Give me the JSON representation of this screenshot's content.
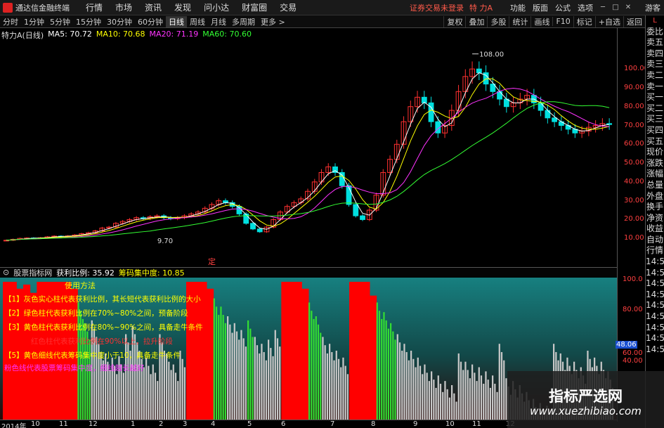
{
  "titlebar": {
    "app_title": "通达信金融终端",
    "menus": [
      "行情",
      "市场",
      "资讯",
      "发现",
      "问小达",
      "财富圈",
      "交易"
    ],
    "login_status": "证券交易未登录",
    "stock_name": "特 力A",
    "system_menus": [
      "功能",
      "版面",
      "公式",
      "选项"
    ],
    "guest": "游客"
  },
  "toolbar": {
    "periods": [
      "分时",
      "1分钟",
      "5分钟",
      "15分钟",
      "30分钟",
      "60分钟",
      "日线",
      "周线",
      "月线",
      "多周期",
      "更多 >"
    ],
    "active_period": "日线",
    "tools": [
      "复权",
      "叠加",
      "多股",
      "统计",
      "画线",
      "F10",
      "标记",
      "+自选",
      "返回"
    ]
  },
  "chart_header": {
    "stock_label": "特力A(日线)",
    "ma": [
      {
        "label": "MA5: 70.72",
        "color": "#ffffff"
      },
      {
        "label": "MA10: 70.68",
        "color": "#ffff00"
      },
      {
        "label": "MA20: 71.19",
        "color": "#ff33ff"
      },
      {
        "label": "MA60: 70.60",
        "color": "#33ff33"
      }
    ]
  },
  "price_axis": [
    "100.00",
    "90.00",
    "80.00",
    "70.00",
    "60.00",
    "50.00",
    "40.00",
    "30.00",
    "20.00",
    "10.00"
  ],
  "annotations": {
    "high": "108.00",
    "low": "9.70",
    "ding": "定"
  },
  "indicator": {
    "name": "股票指标网",
    "metrics": [
      {
        "label": "获利比例: 35.92",
        "color": "#ffffff"
      },
      {
        "label": "筹码集中度: 10.85",
        "color": "#ffff00"
      }
    ],
    "legend_title": "使用方法",
    "legend": [
      {
        "text": "【1】灰色实心柱代表获利比例，其长短代表获利比例的大小",
        "color": "#ffff00"
      },
      {
        "text": "【2】绿色柱代表获利比例在70%~80%之间，预备阶段",
        "color": "#ffff00"
      },
      {
        "text": "【3】黄色柱代表获利比例在80%~90%之间，具备走牛条件",
        "color": "#ffff00"
      },
      {
        "text": "红色柱代表获利比例在90%以上，拉升阶段",
        "color": "#ff3030"
      },
      {
        "text": "【5】黄色细线代表筹码集中度小于10，具备走牛条件",
        "color": "#ffff00"
      },
      {
        "text": "粉色线代表股票筹码集中度，细线越长越好",
        "color": "#ff33ff"
      }
    ],
    "axis": [
      "100.0",
      "80.00",
      "60.00",
      "40.00"
    ],
    "current_value": "48.06"
  },
  "time_axis": [
    "2014年",
    "10",
    "11",
    "12",
    "1",
    "2",
    "3",
    "4",
    "5",
    "6",
    "7",
    "8",
    "9",
    "10",
    "11",
    "12"
  ],
  "right_panel": [
    "L",
    "委比",
    "卖五",
    "卖四",
    "卖三",
    "卖二",
    "卖一",
    "买一",
    "买二",
    "买三",
    "买四",
    "买五",
    "现价",
    "涨跌",
    "涨幅",
    "总量",
    "外盘",
    "换手",
    "净资",
    "收益",
    "自动",
    "行情",
    "14:5",
    "14:5",
    "14:5",
    "14:5",
    "14:5",
    "14:5",
    "14:5",
    "14:5",
    "14:5"
  ],
  "watermark": {
    "title": "指标严选网",
    "url": "www.xuezhibiao.com"
  },
  "colors": {
    "up": "#ff3030",
    "down": "#00e0e0",
    "ma5": "#ffffff",
    "ma10": "#ffff00",
    "ma20": "#ff33ff",
    "ma60": "#33ff33",
    "bar_red": "#ff0000",
    "bar_green": "#33dd33",
    "bar_gray": "#c8c8c8",
    "teal": "#178080"
  },
  "chart_data": {
    "type": "candlestick",
    "ylim": [
      0,
      112
    ],
    "close": [
      9,
      9.5,
      10,
      10.2,
      10.1,
      10.3,
      10.8,
      11.2,
      11,
      11.3,
      11.8,
      12.5,
      13,
      14,
      15.5,
      16,
      18,
      19,
      20,
      21,
      20.5,
      21.5,
      22,
      21,
      20.5,
      21,
      22,
      23,
      24,
      26,
      28,
      30,
      29,
      27,
      23,
      18,
      15,
      13.5,
      16,
      20,
      24,
      27,
      29,
      31,
      35,
      40,
      45,
      48,
      45,
      38,
      28,
      22,
      20,
      25,
      33,
      45,
      52,
      60,
      72,
      80,
      85,
      82,
      72,
      66,
      70,
      78,
      88,
      96,
      100,
      98,
      92,
      88,
      84,
      80,
      82,
      84,
      86,
      82,
      78,
      74,
      72,
      70,
      68,
      66,
      67,
      69,
      70,
      71,
      70.5
    ]
  },
  "indicator_data": {
    "type": "bar",
    "ylim": [
      0,
      100
    ],
    "values": [
      100,
      100,
      95,
      98,
      92,
      100,
      100,
      100,
      100,
      100,
      95,
      85,
      70,
      72,
      55,
      48,
      45,
      46,
      62,
      68,
      50,
      45,
      40,
      62,
      48,
      40,
      50,
      100,
      100,
      100,
      95,
      88,
      82,
      75,
      70,
      65,
      72,
      60,
      55,
      58,
      65,
      100,
      100,
      100,
      95,
      85,
      75,
      60,
      55,
      50,
      45,
      100,
      100,
      100,
      90,
      85,
      78,
      70,
      62,
      55,
      50,
      45,
      40,
      35,
      32,
      28,
      25,
      48,
      42,
      40,
      38,
      35,
      32,
      55,
      30,
      28,
      25,
      20,
      15,
      12,
      10,
      55,
      48,
      45,
      42,
      38,
      50,
      45,
      42,
      35
    ],
    "colors": [
      "r",
      "r",
      "r",
      "r",
      "r",
      "r",
      "r",
      "r",
      "r",
      "r",
      "r",
      "g",
      "g",
      "w",
      "w",
      "w",
      "w",
      "w",
      "w",
      "w",
      "w",
      "w",
      "w",
      "w",
      "w",
      "w",
      "w",
      "r",
      "r",
      "r",
      "r",
      "g",
      "g",
      "w",
      "w",
      "w",
      "g",
      "w",
      "w",
      "w",
      "w",
      "r",
      "r",
      "r",
      "r",
      "g",
      "g",
      "w",
      "w",
      "w",
      "w",
      "r",
      "r",
      "r",
      "r",
      "g",
      "g",
      "g",
      "w",
      "w",
      "w",
      "w",
      "w",
      "w",
      "w",
      "w",
      "w",
      "w",
      "w",
      "w",
      "w",
      "w",
      "w",
      "w",
      "w",
      "w",
      "w",
      "w",
      "w",
      "w",
      "w",
      "w",
      "w",
      "w",
      "w",
      "w",
      "w",
      "w",
      "w",
      "w"
    ]
  }
}
